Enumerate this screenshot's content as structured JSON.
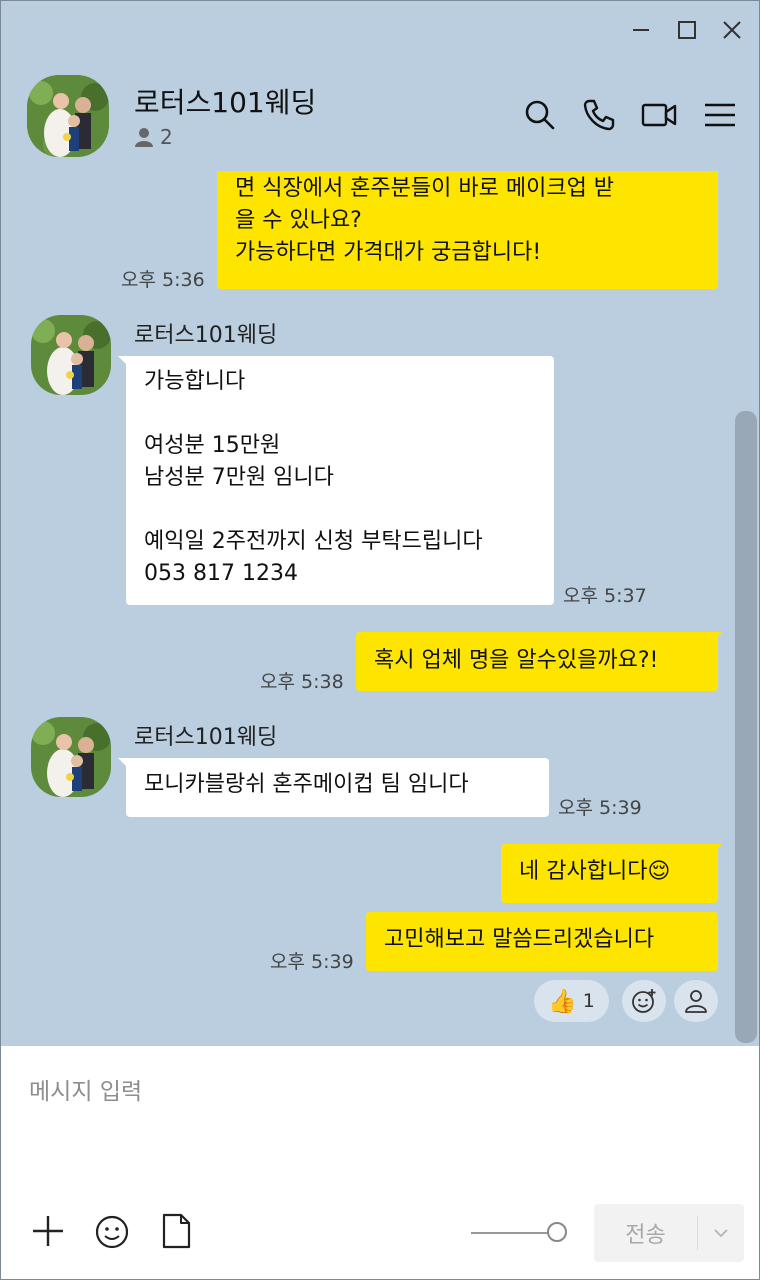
{
  "window": {
    "minimize_icon": "minimize-icon",
    "maximize_icon": "maximize-icon",
    "close_icon": "close-icon"
  },
  "header": {
    "title": "로터스101웨딩",
    "member_count": "2",
    "icons": [
      "search-icon",
      "phone-icon",
      "video-icon",
      "menu-icon"
    ]
  },
  "messages": [
    {
      "from": "me",
      "text": "면 식장에서 혼주분들이 바로 메이크업 받\n을 수 있나요?\n가능하다면 가격대가 궁금합니다!",
      "time": "오후 5:36"
    },
    {
      "from": "them",
      "sender": "로터스101웨딩",
      "text": "가능합니다\n\n여성분 15만원\n남성분 7만원 임니다\n\n예익일 2주전까지 신청 부탁드립니다\n053 817 1234",
      "time": "오후 5:37"
    },
    {
      "from": "me",
      "text": "혹시 업체 명을 알수있을까요?!",
      "time": "오후 5:38"
    },
    {
      "from": "them",
      "sender": "로터스101웨딩",
      "text": "모니카블랑쉬 혼주메이컵  팀 임니다",
      "time": "오후 5:39"
    },
    {
      "from": "me",
      "text": "네 감사합니다😌",
      "time": ""
    },
    {
      "from": "me",
      "text": "고민해보고 말씀드리겠습니다",
      "time": "오후 5:39"
    }
  ],
  "reactions": {
    "thumbs_count": "1",
    "thumbs_emoji": "👍"
  },
  "input": {
    "placeholder": "메시지 입력",
    "send_label": "전송"
  },
  "colors": {
    "chat_background": "#bacee0",
    "my_bubble": "#fee500",
    "their_bubble": "#ffffff"
  }
}
